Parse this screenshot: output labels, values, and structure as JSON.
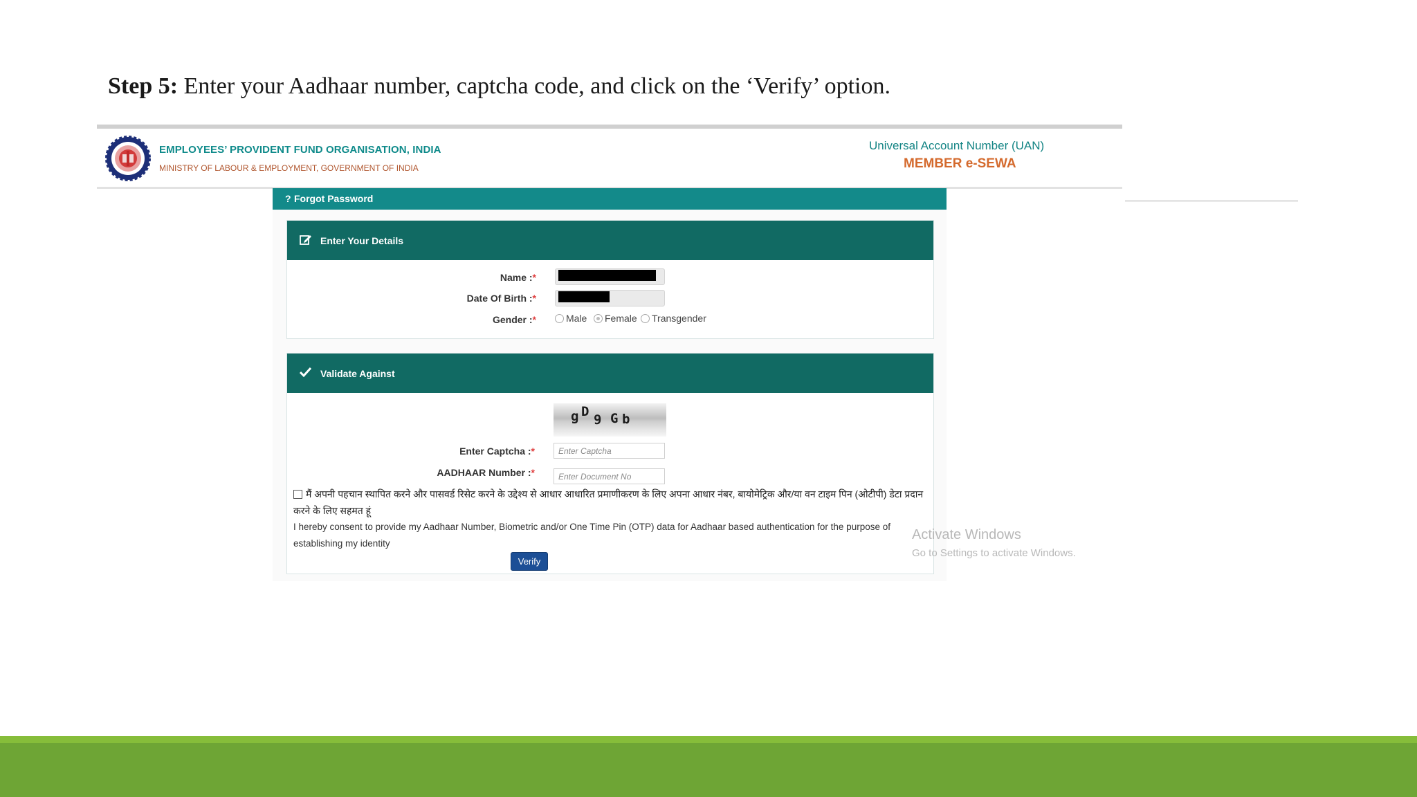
{
  "slide": {
    "step_label": "Step 5:",
    "instruction": "Enter your Aadhaar number, captcha code, and click on the ‘Verify’ option."
  },
  "header": {
    "org_name": "EMPLOYEES’ PROVIDENT FUND ORGANISATION, INDIA",
    "org_subtitle": "MINISTRY OF LABOUR & EMPLOYMENT, GOVERNMENT OF INDIA",
    "portal_title": "Universal Account Number (UAN)",
    "portal_subtitle": "MEMBER e-SEWA"
  },
  "page": {
    "section_icon": "?",
    "section_title": "Forgot Password"
  },
  "details_panel": {
    "title": "Enter Your Details",
    "icon": "edit-icon",
    "name_label": "Name :",
    "dob_label": "Date Of Birth :",
    "gender_label": "Gender :",
    "required_mark": "*",
    "gender_options": [
      "Male",
      "Female",
      "Transgender"
    ],
    "gender_selected": "Female"
  },
  "validate_panel": {
    "title": "Validate Against",
    "icon": "check-icon",
    "captcha_text": "gD9Gb",
    "captcha_label": "Enter Captcha :",
    "captcha_placeholder": "Enter Captcha",
    "aadhaar_label": "AADHAAR Number :",
    "aadhaar_placeholder": "Enter Document No",
    "consent_hindi": "मैं अपनी पहचान स्थापित करने और पासवर्ड रिसेट करने के उद्देश्य से आधार आधारित प्रमाणीकरण के लिए अपना आधार नंबर, बायोमेट्रिक और/या वन टाइम पिन (ओटीपी) डेटा प्रदान करने के लिए सहमत हूं",
    "consent_english": "I hereby consent to provide my Aadhaar Number, Biometric and/or One Time Pin (OTP) data for Aadhaar based authentication for the purpose of establishing my identity",
    "verify_label": "Verify"
  },
  "watermark": {
    "line1": "Activate Windows",
    "line2": "Go to Settings to activate Windows."
  },
  "colors": {
    "teal_header": "#138a8a",
    "panel_header": "#116a63",
    "verify_button": "#1c4f96",
    "footer_band": "#6ea535"
  }
}
